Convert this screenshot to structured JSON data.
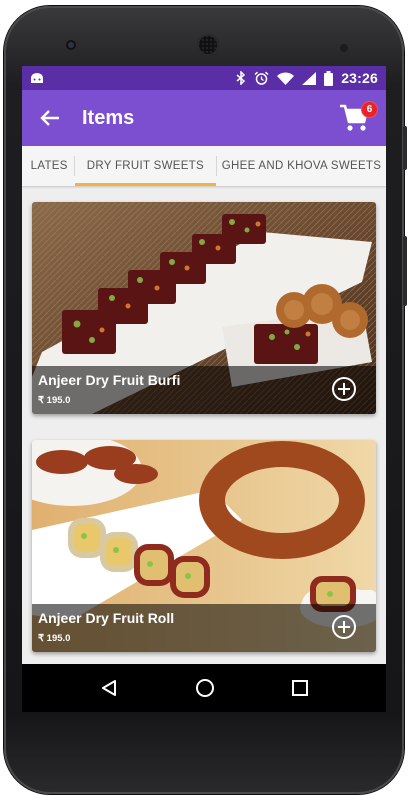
{
  "status_bar": {
    "time": "23:26",
    "icons": [
      "android-icon",
      "bluetooth-icon",
      "alarm-icon",
      "wifi-icon",
      "signal-icon",
      "battery-icon"
    ]
  },
  "app_bar": {
    "title": "Items",
    "back_icon": "arrow-left-icon",
    "cart_icon": "shopping-cart-icon",
    "cart_count": "6"
  },
  "tabs": [
    {
      "label": "LATES",
      "active": false
    },
    {
      "label": "DRY FRUIT SWEETS",
      "active": true
    },
    {
      "label": "GHEE AND KHOVA SWEETS",
      "active": false
    }
  ],
  "items": [
    {
      "name": "Anjeer Dry Fruit Burfi",
      "price": "₹ 195.0",
      "add_icon": "plus-circle-icon"
    },
    {
      "name": "Anjeer Dry Fruit Roll",
      "price": "₹ 195.0",
      "add_icon": "plus-circle-icon"
    }
  ],
  "nav_bar": {
    "icons": [
      "back-triangle-icon",
      "home-circle-icon",
      "recents-square-icon"
    ]
  },
  "colors": {
    "status_bar": "#5a2ea6",
    "app_bar": "#7b4fd0",
    "tab_indicator": "#f4b33a",
    "badge": "#e8242b"
  }
}
